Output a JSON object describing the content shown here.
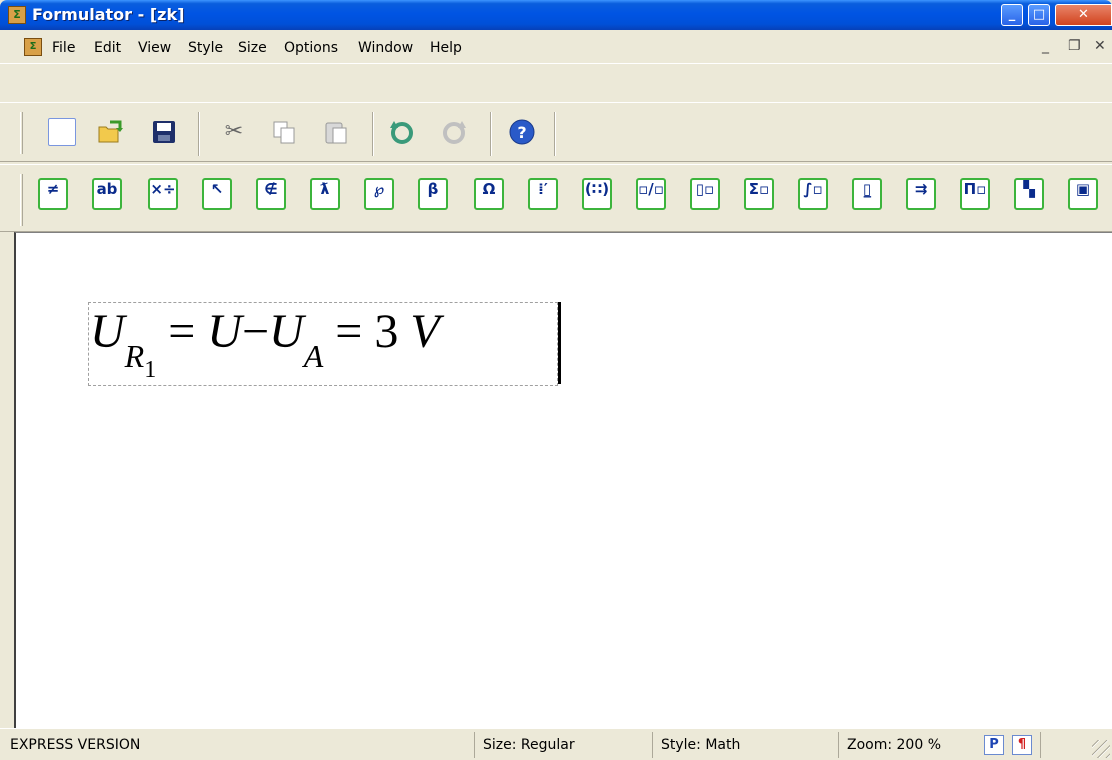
{
  "window": {
    "title": "Formulator - [zk]",
    "controls": {
      "minimize": "_",
      "maximize": "□",
      "close": "✕"
    }
  },
  "menu": {
    "items": [
      "File",
      "Edit",
      "View",
      "Style",
      "Size",
      "Options",
      "Window",
      "Help"
    ],
    "mdi_controls": {
      "minimize": "_",
      "restore": "❐",
      "close": "✕"
    }
  },
  "toolbar_standard": {
    "icons": [
      "new-icon",
      "open-icon",
      "save-icon",
      "cut-icon",
      "copy-icon",
      "paste-icon",
      "undo-icon",
      "redo-icon",
      "help-icon"
    ]
  },
  "toolbar_formula": {
    "buttons": [
      {
        "glyph": "≠",
        "icon": "relations-icon"
      },
      {
        "glyph": "ab",
        "icon": "accents-icon"
      },
      {
        "glyph": "×÷",
        "icon": "operators-icon"
      },
      {
        "glyph": "↖",
        "icon": "arrows-icon"
      },
      {
        "glyph": "∉",
        "icon": "sets-icon"
      },
      {
        "glyph": "ƛ",
        "icon": "misc-symbols-icon"
      },
      {
        "glyph": "℘",
        "icon": "spacing-icon"
      },
      {
        "glyph": "β",
        "icon": "greek-lower-icon"
      },
      {
        "glyph": "Ω",
        "icon": "greek-upper-icon"
      },
      {
        "glyph": "⁞′",
        "icon": "fences-icon"
      },
      {
        "glyph": "(∷)",
        "icon": "brackets-icon"
      },
      {
        "glyph": "▫/▫",
        "icon": "fractions-icon"
      },
      {
        "glyph": "▯▫",
        "icon": "scripts-icon"
      },
      {
        "glyph": "Σ▫",
        "icon": "summation-icon"
      },
      {
        "glyph": "∫▫",
        "icon": "integrals-icon"
      },
      {
        "glyph": "▯̲",
        "icon": "underbar-icon"
      },
      {
        "glyph": "⇉",
        "icon": "labeled-arrows-icon"
      },
      {
        "glyph": "Π▫",
        "icon": "products-icon"
      },
      {
        "glyph": "▚",
        "icon": "matrices-icon"
      },
      {
        "glyph": "▣",
        "icon": "boxes-icon"
      }
    ]
  },
  "document": {
    "formula": {
      "U1": "U",
      "sub_R": "R",
      "sub_1": "1",
      "eq1": "=",
      "U2": "U",
      "minus": "−",
      "U3": "U",
      "sub_A": "A",
      "eq2": "=",
      "three": "3",
      "V": "V"
    }
  },
  "status": {
    "version": "EXPRESS VERSION",
    "size": "Size: Regular",
    "style": "Style: Math",
    "zoom": "Zoom: 200 %",
    "p_btn": "P",
    "para_btn": "¶"
  }
}
